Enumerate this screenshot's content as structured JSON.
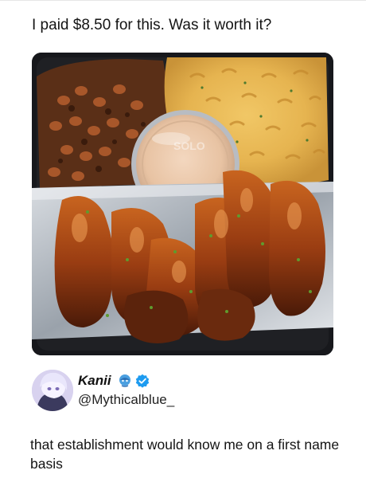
{
  "post": {
    "caption": "I paid $8.50 for this. Was it worth it?",
    "image": {
      "icon": "food-plate-photo",
      "lid_text": "SOLO"
    }
  },
  "reply": {
    "author": {
      "display_name": "Kanii",
      "handle": "@Mythicalblue_",
      "badges": [
        "emoji-badge-icon",
        "verified-badge-icon"
      ],
      "verified_color": "#1d9bf0"
    },
    "text": "that establishment would know me on a first name basis"
  }
}
